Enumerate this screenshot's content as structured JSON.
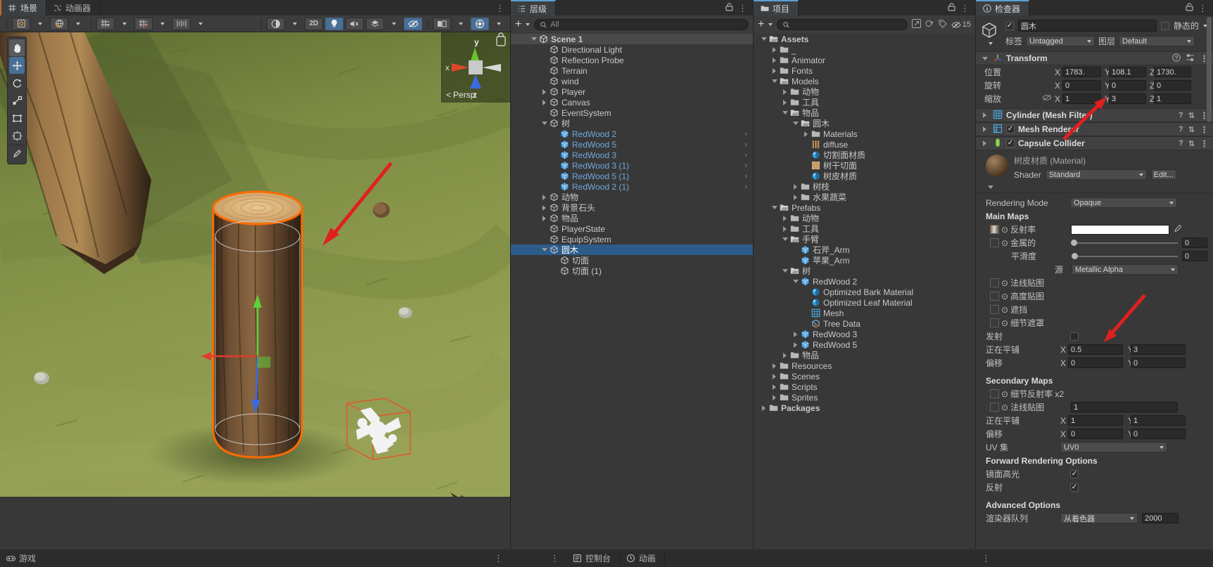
{
  "scene_panel": {
    "tabs": [
      {
        "label": "场景",
        "icon": "grid-icon",
        "active": true
      },
      {
        "label": "动画器",
        "icon": "animator-icon",
        "active": false
      }
    ],
    "toolbar_left": [
      {
        "name": "pan-tool",
        "glyph": "✋"
      },
      {
        "name": "move-tool",
        "glyph": "✥"
      },
      {
        "name": "rotate-tool",
        "glyph": "⟳"
      },
      {
        "name": "scale-tool",
        "glyph": "⤢"
      },
      {
        "name": "rect-tool",
        "glyph": "▭"
      },
      {
        "name": "transform-tool",
        "glyph": "✣"
      },
      {
        "name": "custom-tool",
        "glyph": "✎"
      }
    ],
    "toolbar": [
      {
        "name": "pivot-mode",
        "label": "⊙",
        "has_caret": true
      },
      {
        "name": "handle-space",
        "label": "🌐",
        "has_caret": true
      },
      {
        "name": "grid-snap",
        "label": "⌗",
        "has_caret": true
      },
      {
        "name": "snap-increment",
        "label": "⌗",
        "has_caret": true
      },
      {
        "name": "layout-tool",
        "label": "⊫",
        "has_caret": true
      },
      {
        "name": "shading-mode",
        "label": "◑",
        "has_caret": true
      },
      {
        "name": "2d-toggle",
        "label": "2D",
        "has_caret": false
      },
      {
        "name": "lighting-toggle",
        "label": "💡",
        "has_caret": false,
        "on": true
      },
      {
        "name": "audio-toggle",
        "label": "🔇",
        "has_caret": false
      },
      {
        "name": "effects-toggle",
        "label": "✦",
        "has_caret": true
      },
      {
        "name": "hidden-objects-toggle",
        "label": "⊘",
        "has_caret": false,
        "on": true
      },
      {
        "name": "scene-camera",
        "label": "▣",
        "has_caret": true
      },
      {
        "name": "gizmos-toggle",
        "label": "◈",
        "has_caret": true,
        "on": true
      }
    ],
    "gizmo": {
      "x_label": "x",
      "y_label": "y",
      "z_label": "z",
      "mode": "Persp"
    },
    "game_tab_label": "游戏"
  },
  "hierarchy": {
    "tab_label": "层级",
    "search_placeholder": "All",
    "items": [
      {
        "label": "Scene 1",
        "depth": 0,
        "arrow": "down",
        "icon": "unity-icon",
        "bold": true,
        "header": true
      },
      {
        "label": "Directional Light",
        "depth": 1,
        "arrow": "none",
        "icon": "cube-icon"
      },
      {
        "label": "Reflection Probe",
        "depth": 1,
        "arrow": "none",
        "icon": "cube-icon"
      },
      {
        "label": "Terrain",
        "depth": 1,
        "arrow": "none",
        "icon": "cube-icon"
      },
      {
        "label": "wind",
        "depth": 1,
        "arrow": "none",
        "icon": "cube-icon"
      },
      {
        "label": "Player",
        "depth": 1,
        "arrow": "right",
        "icon": "cube-icon"
      },
      {
        "label": "Canvas",
        "depth": 1,
        "arrow": "right",
        "icon": "cube-icon"
      },
      {
        "label": "EventSystem",
        "depth": 1,
        "arrow": "none",
        "icon": "cube-icon"
      },
      {
        "label": "树",
        "depth": 1,
        "arrow": "down",
        "icon": "cube-icon"
      },
      {
        "label": "RedWood 2",
        "depth": 2,
        "arrow": "none",
        "icon": "prefab-icon",
        "prefab": true,
        "chevron": true
      },
      {
        "label": "RedWood 5",
        "depth": 2,
        "arrow": "none",
        "icon": "prefab-icon",
        "prefab": true,
        "chevron": true
      },
      {
        "label": "RedWood 3",
        "depth": 2,
        "arrow": "none",
        "icon": "prefab-icon",
        "prefab": true,
        "chevron": true
      },
      {
        "label": "RedWood 3 (1)",
        "depth": 2,
        "arrow": "none",
        "icon": "prefab-icon",
        "prefab": true,
        "chevron": true
      },
      {
        "label": "RedWood 5 (1)",
        "depth": 2,
        "arrow": "none",
        "icon": "prefab-icon",
        "prefab": true,
        "chevron": true
      },
      {
        "label": "RedWood 2 (1)",
        "depth": 2,
        "arrow": "none",
        "icon": "prefab-icon",
        "prefab": true,
        "chevron": true
      },
      {
        "label": "动物",
        "depth": 1,
        "arrow": "right",
        "icon": "cube-icon"
      },
      {
        "label": "背景石头",
        "depth": 1,
        "arrow": "right",
        "icon": "cube-icon"
      },
      {
        "label": "物品",
        "depth": 1,
        "arrow": "right",
        "icon": "cube-icon"
      },
      {
        "label": "PlayerState",
        "depth": 1,
        "arrow": "none",
        "icon": "cube-icon"
      },
      {
        "label": "EquipSystem",
        "depth": 1,
        "arrow": "none",
        "icon": "cube-icon"
      },
      {
        "label": "圆木",
        "depth": 1,
        "arrow": "down",
        "icon": "cube-icon",
        "selected": true
      },
      {
        "label": "切面",
        "depth": 2,
        "arrow": "none",
        "icon": "cube-icon"
      },
      {
        "label": "切面 (1)",
        "depth": 2,
        "arrow": "none",
        "icon": "cube-icon"
      }
    ]
  },
  "project": {
    "tab_label": "项目",
    "search_placeholder": "",
    "visible_count": "15",
    "items": [
      {
        "label": "Assets",
        "depth": 0,
        "arrow": "down",
        "icon": "folder-open-icon",
        "bold": true
      },
      {
        "label": "_",
        "depth": 1,
        "arrow": "right",
        "icon": "folder-icon"
      },
      {
        "label": "Animator",
        "depth": 1,
        "arrow": "right",
        "icon": "folder-icon"
      },
      {
        "label": "Fonts",
        "depth": 1,
        "arrow": "right",
        "icon": "folder-icon"
      },
      {
        "label": "Models",
        "depth": 1,
        "arrow": "down",
        "icon": "folder-open-icon"
      },
      {
        "label": "动物",
        "depth": 2,
        "arrow": "right",
        "icon": "folder-icon"
      },
      {
        "label": "工具",
        "depth": 2,
        "arrow": "right",
        "icon": "folder-icon"
      },
      {
        "label": "物品",
        "depth": 2,
        "arrow": "down",
        "icon": "folder-open-icon"
      },
      {
        "label": "圆木",
        "depth": 3,
        "arrow": "down",
        "icon": "folder-open-icon"
      },
      {
        "label": "Materials",
        "depth": 4,
        "arrow": "right",
        "icon": "folder-icon"
      },
      {
        "label": "diffuse",
        "depth": 4,
        "arrow": "none",
        "icon": "texture-icon"
      },
      {
        "label": "切割面材质",
        "depth": 4,
        "arrow": "none",
        "icon": "material-icon"
      },
      {
        "label": "树干切面",
        "depth": 4,
        "arrow": "none",
        "icon": "texture-round-icon"
      },
      {
        "label": "树皮材质",
        "depth": 4,
        "arrow": "none",
        "icon": "material-icon"
      },
      {
        "label": "树枝",
        "depth": 3,
        "arrow": "right",
        "icon": "folder-icon"
      },
      {
        "label": "水果蔬菜",
        "depth": 3,
        "arrow": "right",
        "icon": "folder-icon"
      },
      {
        "label": "Prefabs",
        "depth": 1,
        "arrow": "down",
        "icon": "folder-open-icon"
      },
      {
        "label": "动物",
        "depth": 2,
        "arrow": "right",
        "icon": "folder-icon"
      },
      {
        "label": "工具",
        "depth": 2,
        "arrow": "right",
        "icon": "folder-icon"
      },
      {
        "label": "手臂",
        "depth": 2,
        "arrow": "down",
        "icon": "folder-open-icon"
      },
      {
        "label": "石斧_Arm",
        "depth": 3,
        "arrow": "none",
        "icon": "prefab-icon"
      },
      {
        "label": "苹果_Arm",
        "depth": 3,
        "arrow": "none",
        "icon": "prefab-icon"
      },
      {
        "label": "树",
        "depth": 2,
        "arrow": "down",
        "icon": "folder-open-icon"
      },
      {
        "label": "RedWood 2",
        "depth": 3,
        "arrow": "down",
        "icon": "prefab-icon"
      },
      {
        "label": "Optimized Bark Material",
        "depth": 4,
        "arrow": "none",
        "icon": "material-icon"
      },
      {
        "label": "Optimized Leaf Material",
        "depth": 4,
        "arrow": "none",
        "icon": "material-icon"
      },
      {
        "label": "Mesh",
        "depth": 4,
        "arrow": "none",
        "icon": "mesh-icon"
      },
      {
        "label": "Tree Data",
        "depth": 4,
        "arrow": "none",
        "icon": "tree-data-icon"
      },
      {
        "label": "RedWood 3",
        "depth": 3,
        "arrow": "right",
        "icon": "prefab-icon"
      },
      {
        "label": "RedWood 5",
        "depth": 3,
        "arrow": "right",
        "icon": "prefab-icon"
      },
      {
        "label": "物品",
        "depth": 2,
        "arrow": "right",
        "icon": "folder-icon"
      },
      {
        "label": "Resources",
        "depth": 1,
        "arrow": "right",
        "icon": "folder-icon"
      },
      {
        "label": "Scenes",
        "depth": 1,
        "arrow": "right",
        "icon": "folder-icon"
      },
      {
        "label": "Scripts",
        "depth": 1,
        "arrow": "right",
        "icon": "folder-icon"
      },
      {
        "label": "Sprites",
        "depth": 1,
        "arrow": "right",
        "icon": "folder-icon"
      },
      {
        "label": "Packages",
        "depth": 0,
        "arrow": "right",
        "icon": "folder-icon",
        "bold": true
      }
    ]
  },
  "inspector": {
    "tab_label": "检查器",
    "object_name": "圆木",
    "enabled": true,
    "static_label": "静态的",
    "static_checked": false,
    "tag_label": "标签",
    "tag_value": "Untagged",
    "layer_label": "图层",
    "layer_value": "Default",
    "transform": {
      "title": "Transform",
      "position_label": "位置",
      "rotation_label": "旋转",
      "scale_label": "缩放",
      "position": {
        "x": "1783.",
        "y": "108.1",
        "z": "1730."
      },
      "rotation": {
        "x": "0",
        "y": "0",
        "z": "0"
      },
      "scale": {
        "x": "1",
        "y": "3",
        "z": "1"
      }
    },
    "components": [
      {
        "name": "Cylinder (Mesh Filter)",
        "icon": "mesh-filter-icon",
        "has_checkbox": false
      },
      {
        "name": "Mesh Renderer",
        "icon": "mesh-renderer-icon",
        "has_checkbox": true,
        "checked": true
      },
      {
        "name": "Capsule Collider",
        "icon": "collider-icon",
        "has_checkbox": true,
        "checked": true
      }
    ],
    "material": {
      "title": "树皮材质 (Material)",
      "shader_label": "Shader",
      "shader_value": "Standard",
      "edit_label": "Edit...",
      "rendering_mode_label": "Rendering Mode",
      "rendering_mode_value": "Opaque",
      "main_maps_label": "Main Maps",
      "albedo_label": "反射率",
      "metallic_label": "金属的",
      "metallic_value": "0",
      "smoothness_label": "平滑度",
      "smoothness_value": "0",
      "source_label": "源",
      "source_value": "Metallic Alpha",
      "normal_map_label": "法线贴图",
      "height_map_label": "高度贴图",
      "occlusion_label": "遮挡",
      "detail_mask_label": "细节遮罩",
      "emission_label": "发射",
      "tiling_label": "正在平铺",
      "offset_label": "偏移",
      "tiling": {
        "x": "0.5",
        "y": "3"
      },
      "offset": {
        "x": "0",
        "y": "0"
      },
      "secondary_maps_label": "Secondary Maps",
      "detail_albedo_label": "细节反射率 x2",
      "detail_normal_label": "法线贴图",
      "detail_normal_value": "1",
      "sec_tiling": {
        "x": "1",
        "y": "1"
      },
      "sec_offset": {
        "x": "0",
        "y": "0"
      },
      "uv_set_label": "UV 集",
      "uv_set_value": "UV0",
      "forward_rendering_label": "Forward Rendering Options",
      "specular_highlights_label": "镜面高光",
      "specular_highlights_checked": true,
      "reflections_label": "反射",
      "reflections_checked": true,
      "advanced_options_label": "Advanced Options",
      "render_queue_label": "渲染器队列",
      "render_queue_value": "从着色器",
      "render_queue_number": "2000"
    }
  },
  "bottom_bar": {
    "tabs": [
      {
        "label": "控制台",
        "icon": "console-icon"
      },
      {
        "label": "动画",
        "icon": "animation-icon"
      }
    ]
  },
  "colors": {
    "accent_blue": "#2c5c8a",
    "prefab_blue": "#6fa8dc",
    "selection_orange": "#ff6a00",
    "annotation_red": "#e02020",
    "panel_bg": "#383838",
    "panel_dark": "#2c2c2c"
  }
}
